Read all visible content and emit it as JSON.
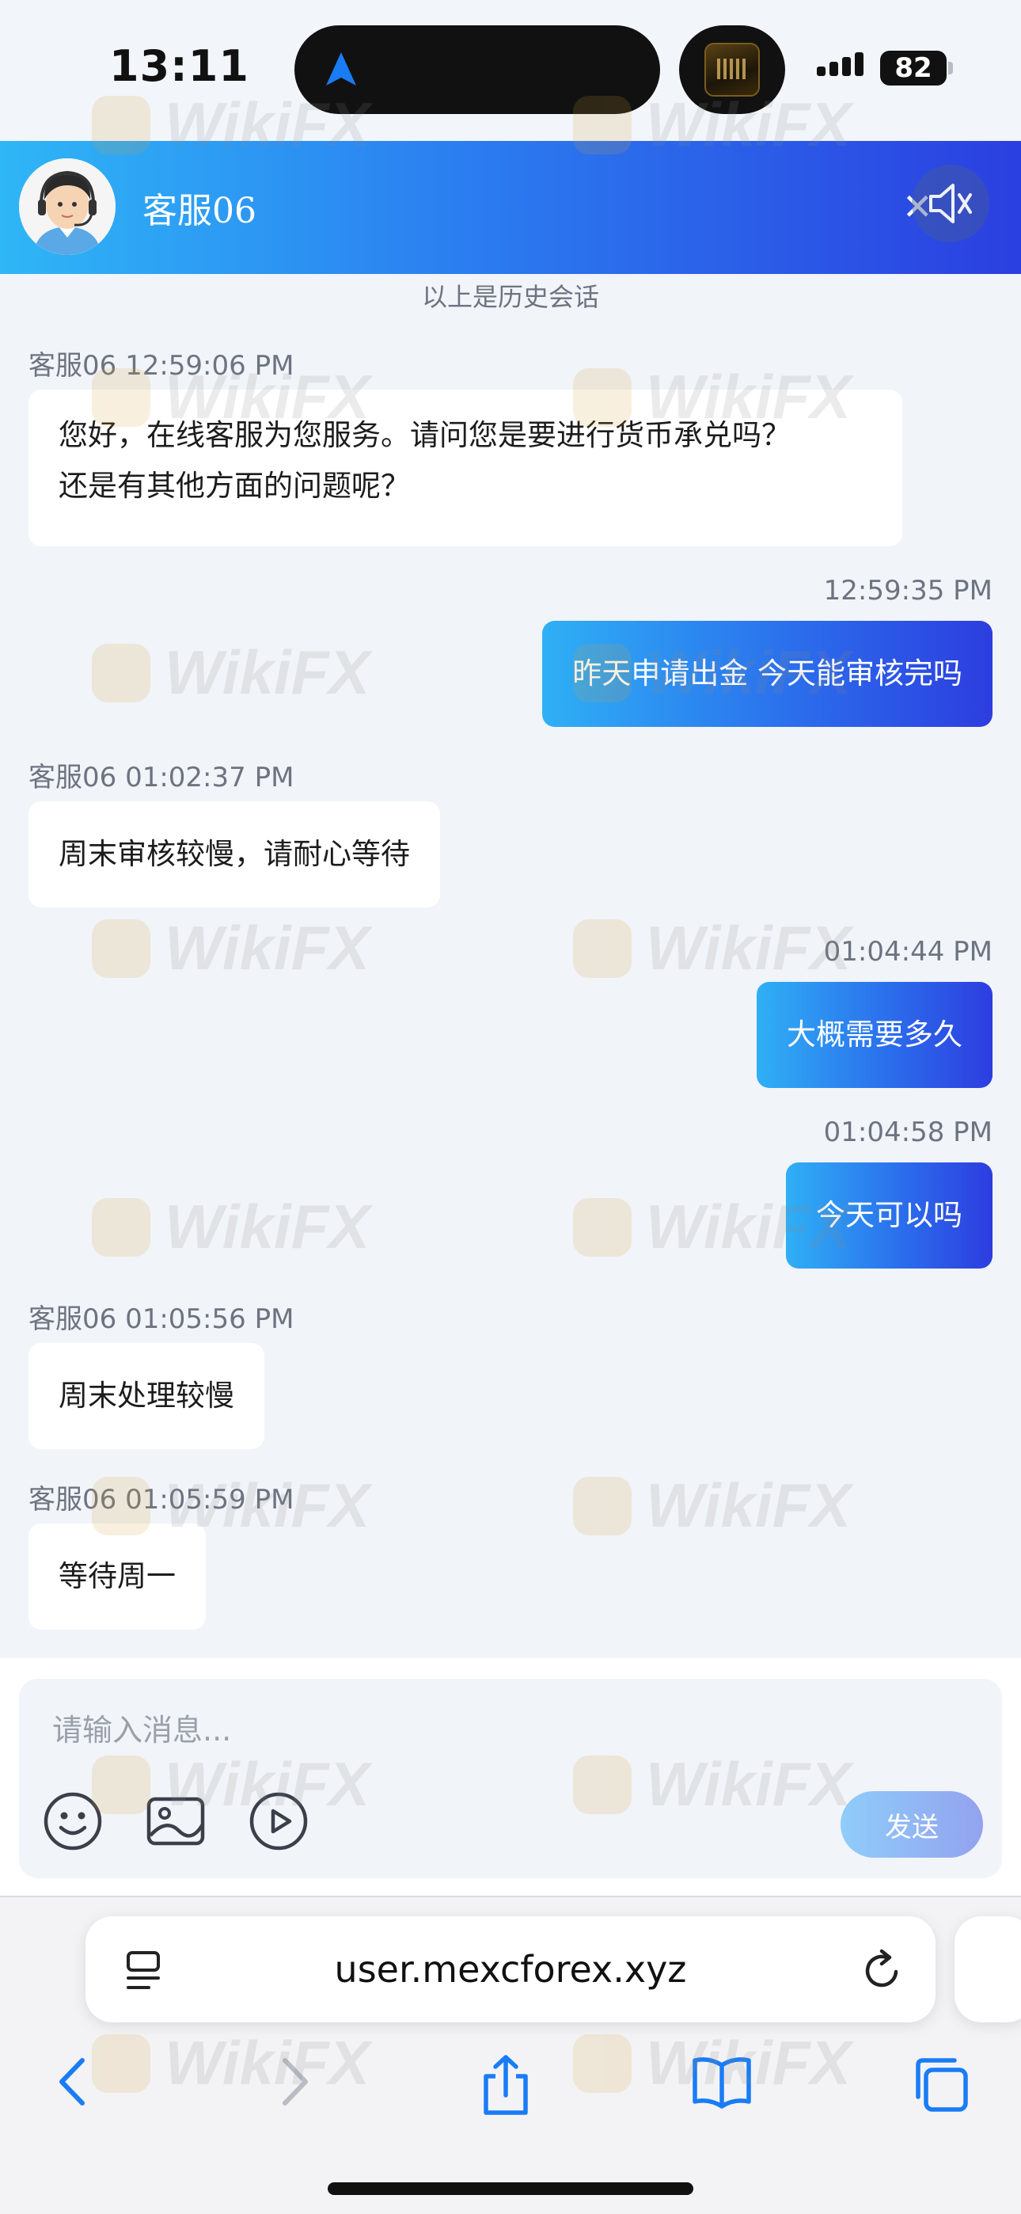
{
  "status_bar": {
    "time": "13:11",
    "battery": "82"
  },
  "header": {
    "agent_name": "客服06",
    "close_glyph": "✕"
  },
  "conversation": {
    "history_note": "以上是历史会话",
    "messages": [
      {
        "side": "in",
        "meta": "客服06 12:59:06 PM",
        "lines": [
          "您好，在线客服为您服务。请问您是要进行货币承兑吗？",
          "还是有其他方面的问题呢？"
        ]
      },
      {
        "side": "out",
        "meta": "12:59:35 PM",
        "lines": [
          "昨天申请出金 今天能审核完吗"
        ]
      },
      {
        "side": "in",
        "meta": "客服06 01:02:37 PM",
        "lines": [
          "周末审核较慢，请耐心等待"
        ]
      },
      {
        "side": "out",
        "meta": "01:04:44 PM",
        "lines": [
          "大概需要多久"
        ]
      },
      {
        "side": "out",
        "meta": "01:04:58 PM",
        "lines": [
          "今天可以吗"
        ]
      },
      {
        "side": "in",
        "meta": "客服06 01:05:56 PM",
        "lines": [
          "周末处理较慢"
        ]
      },
      {
        "side": "in",
        "meta": "客服06 01:05:59 PM",
        "lines": [
          "等待周一"
        ]
      }
    ]
  },
  "composer": {
    "placeholder": "请输入消息...",
    "send_label": "发送",
    "tools": [
      "emoji-icon",
      "image-icon",
      "video-icon"
    ]
  },
  "browser": {
    "url": "user.mexcforex.xyz",
    "toolbar": [
      "back-icon",
      "forward-icon",
      "share-icon",
      "bookmarks-icon",
      "tabs-icon"
    ]
  },
  "watermark": {
    "text": "WikiFX"
  },
  "colors": {
    "header_gradient": [
      "#2fb6f6",
      "#2b3fe0"
    ],
    "out_bubble_gradient": [
      "#2fb0f5",
      "#2d3ddf"
    ],
    "in_bubble": "#ffffff",
    "page_bg": "#f1f4f9",
    "ios_blue": "#1a7cf5"
  }
}
